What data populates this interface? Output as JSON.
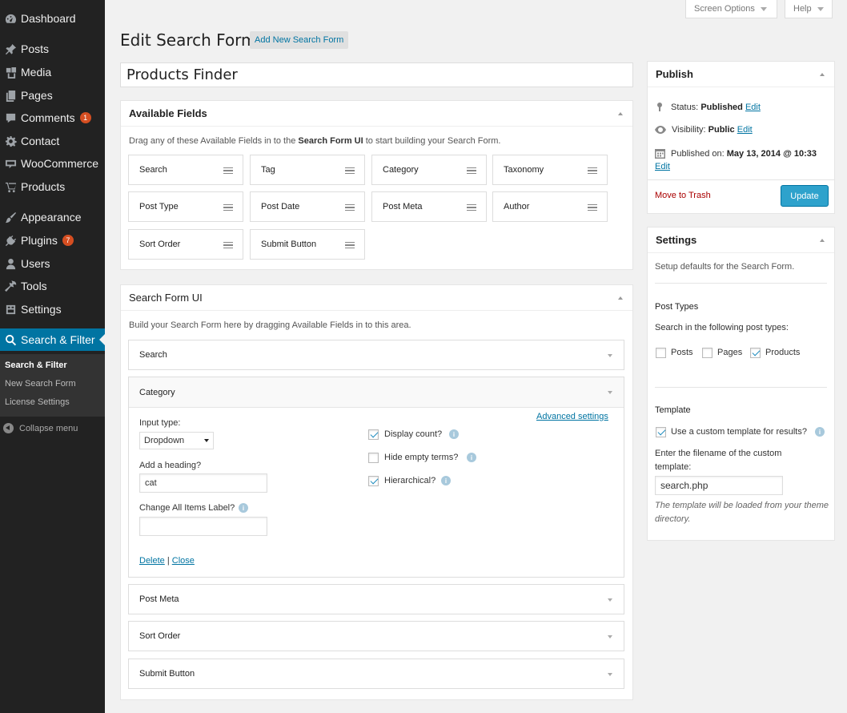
{
  "sidebar": {
    "items": [
      {
        "label": "Dashboard",
        "icon": "dashboard-icon"
      },
      {
        "label": "Posts",
        "icon": "pin-icon"
      },
      {
        "label": "Media",
        "icon": "media-icon"
      },
      {
        "label": "Pages",
        "icon": "pages-icon"
      },
      {
        "label": "Comments",
        "icon": "comment-icon",
        "badge": "1"
      },
      {
        "label": "Contact",
        "icon": "gear-icon"
      },
      {
        "label": "WooCommerce",
        "icon": "woo-icon"
      },
      {
        "label": "Products",
        "icon": "cart-icon"
      },
      {
        "label": "Appearance",
        "icon": "brush-icon"
      },
      {
        "label": "Plugins",
        "icon": "plug-icon",
        "badge": "7"
      },
      {
        "label": "Users",
        "icon": "user-icon"
      },
      {
        "label": "Tools",
        "icon": "wrench-icon"
      },
      {
        "label": "Settings",
        "icon": "settings-icon"
      },
      {
        "label": "Search & Filter",
        "icon": "search-icon"
      }
    ],
    "submenu": [
      "Search & Filter",
      "New Search Form",
      "License Settings"
    ],
    "collapse": "Collapse menu"
  },
  "top": {
    "screen_options": "Screen Options",
    "help": "Help"
  },
  "header": {
    "title": "Edit Search Form",
    "add_new": "Add New Search Form"
  },
  "form_title": "Products Finder",
  "available_fields": {
    "title": "Available Fields",
    "desc_pre": "Drag any of these Available Fields in to the ",
    "desc_bold": "Search Form UI",
    "desc_post": " to start building your Search Form.",
    "fields": [
      "Search",
      "Tag",
      "Category",
      "Taxonomy",
      "Post Type",
      "Post Date",
      "Post Meta",
      "Author",
      "Sort Order",
      "Submit Button"
    ]
  },
  "search_form_ui": {
    "title": "Search Form UI",
    "desc": "Build your Search Form here by dragging Available Fields in to this area.",
    "fields": [
      "Search",
      "Category",
      "Post Meta",
      "Sort Order",
      "Submit Button"
    ],
    "open": {
      "input_type_label": "Input type:",
      "input_type_value": "Dropdown",
      "heading_label": "Add a heading?",
      "heading_value": "cat",
      "change_all_label": "Change All Items Label?",
      "change_all_value": "",
      "advanced": "Advanced settings",
      "display_count": "Display count?",
      "hide_empty": "Hide empty terms?",
      "hierarchical": "Hierarchical?",
      "delete": "Delete",
      "sep": "|",
      "close": "Close"
    }
  },
  "publish": {
    "title": "Publish",
    "status_label": "Status:",
    "status_value": "Published",
    "visibility_label": "Visibility:",
    "visibility_value": "Public",
    "published_label": "Published on:",
    "published_value": "May 13, 2014 @ 10:33",
    "edit": "Edit",
    "trash": "Move to Trash",
    "update": "Update"
  },
  "settings": {
    "title": "Settings",
    "desc": "Setup defaults for the Search Form.",
    "post_types_heading": "Post Types",
    "post_types_desc": "Search in the following post types:",
    "post_types": [
      {
        "label": "Posts",
        "checked": false
      },
      {
        "label": "Pages",
        "checked": false
      },
      {
        "label": "Products",
        "checked": true
      }
    ],
    "template_heading": "Template",
    "custom_template": "Use a custom template for results?",
    "filename_label": "Enter the filename of the custom template:",
    "filename_value": "search.php",
    "note": "The template will be loaded from your theme directory."
  },
  "colors": {
    "sidebar": "#222222",
    "current": "#0074a2",
    "primary_button": "#2ea2cc",
    "badge": "#d54e21",
    "trash": "#aa0000"
  }
}
